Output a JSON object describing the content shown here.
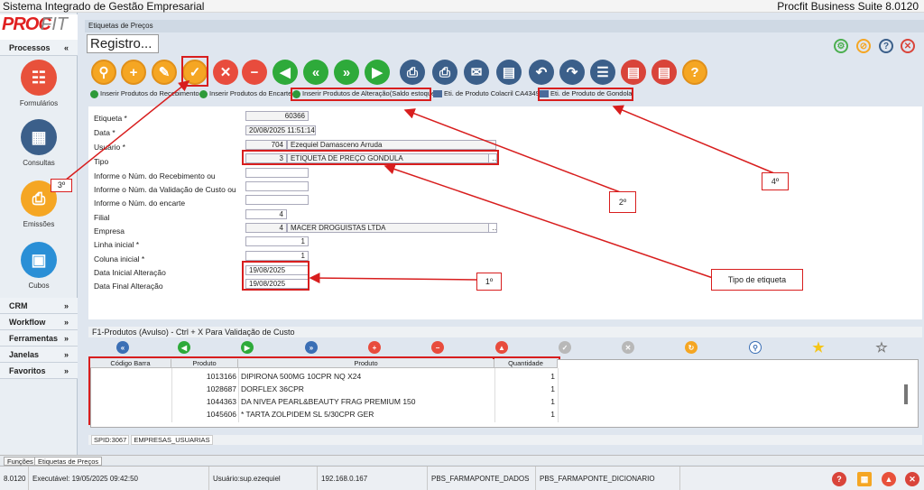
{
  "app": {
    "title": "Sistema Integrado de Gestão Empresarial",
    "suite": "Procfit Business Suite 8.0120",
    "logo_a": "PROC",
    "logo_b": "FIT"
  },
  "sidebar": {
    "sections": [
      {
        "label": "Processos",
        "chev": "«"
      },
      {
        "label": "CRM",
        "chev": "»"
      },
      {
        "label": "Workflow",
        "chev": "»"
      },
      {
        "label": "Ferramentas",
        "chev": "»"
      },
      {
        "label": "Janelas",
        "chev": "»"
      },
      {
        "label": "Favoritos",
        "chev": "»"
      }
    ],
    "items": [
      {
        "label": "Formulários",
        "icon": "sitemap-icon",
        "color": "#e8513b"
      },
      {
        "label": "Consultas",
        "icon": "table-icon",
        "color": "#3b5f8a"
      },
      {
        "label": "Emissões",
        "icon": "printer-icon",
        "color": "#f5a623"
      },
      {
        "label": "Cubos",
        "icon": "cubes-icon",
        "color": "#2a8fd6"
      }
    ]
  },
  "window": {
    "header": "Etiquetas de Preços",
    "register_button": "Registro...",
    "top_icons": [
      "settings-icon",
      "cancel-icon",
      "help-icon",
      "close-icon"
    ]
  },
  "actions": [
    {
      "label": "Inserir Produtos do Recebimento",
      "icon": "green"
    },
    {
      "label": "Inserir Produtos do Encarte",
      "icon": "green"
    },
    {
      "label": "Inserir Produtos de Alteração(Saldo estoque)",
      "icon": "green"
    },
    {
      "label": "Eti. de Produto Colacril CA4349",
      "icon": "table"
    },
    {
      "label": "Eti. de Produto de Gondola",
      "icon": "table"
    }
  ],
  "form": {
    "labels": {
      "etiqueta": "Etiqueta *",
      "data": "Data *",
      "usuario": "Usuário *",
      "tipo": "Tipo",
      "recebimento": "Informe o Núm. do Recebimento ou",
      "validacao": "Informe o Núm. da Validação de Custo ou",
      "encarte": "Informe o Núm. do encarte",
      "filial": "Filial",
      "empresa": "Empresa",
      "linha": "Linha inicial *",
      "coluna": "Coluna inicial *",
      "data_ini": "Data Inicial Alteração",
      "data_fim": "Data Final Alteração"
    },
    "values": {
      "etiqueta": "60366",
      "data": "20/08/2025 11:51:14",
      "usuario_id": "704",
      "usuario_nome": "Ezequiel Damasceno Arruda",
      "tipo_id": "3",
      "tipo_nome": "ETIQUETA DE PREÇO GONDULA",
      "filial": "4",
      "empresa_id": "4",
      "empresa_nome": "MACER DROGUISTAS LTDA",
      "linha": "1",
      "coluna": "1",
      "data_ini": "19/08/2025",
      "data_fim": "19/08/2025"
    }
  },
  "callouts": {
    "c1": "1º",
    "c2": "2º",
    "c3": "3º",
    "c4": "4º",
    "tipo": "Tipo de etiqueta"
  },
  "grid": {
    "header": "F1-Produtos (Avulso) - Ctrl + X Para Validação de Custo",
    "columns": [
      "Código Barra",
      "Produto",
      "Produto",
      "Quantidade"
    ],
    "rows": [
      {
        "codigo": "",
        "produto_id": "1013166",
        "produto": "DIPIRONA 500MG 10CPR NQ  X24",
        "qtd": "1"
      },
      {
        "codigo": "",
        "produto_id": "1028687",
        "produto": "DORFLEX 36CPR",
        "qtd": "1"
      },
      {
        "codigo": "",
        "produto_id": "1044363",
        "produto": "DA NIVEA PEARL&BEAUTY FRAG PREMIUM 150",
        "qtd": "1"
      },
      {
        "codigo": "",
        "produto_id": "1045606",
        "produto": "* TARTA ZOLPIDEM SL 5/30CPR GER",
        "qtd": "1"
      }
    ]
  },
  "spid": {
    "label": "SPID:3067",
    "value": "EMPRESAS_USUARIAS"
  },
  "bottom_tabs": [
    "Funções",
    "Etiquetas de Preços"
  ],
  "status": {
    "version": "8.0120",
    "executavel": "Executável: 19/05/2025 09:42:50",
    "usuario": "Usuário:sup.ezequiel",
    "ip": "192.168.0.167",
    "db_dados": "PBS_FARMAPONTE_DADOS",
    "db_dic": "PBS_FARMAPONTE_DICIONARIO"
  }
}
